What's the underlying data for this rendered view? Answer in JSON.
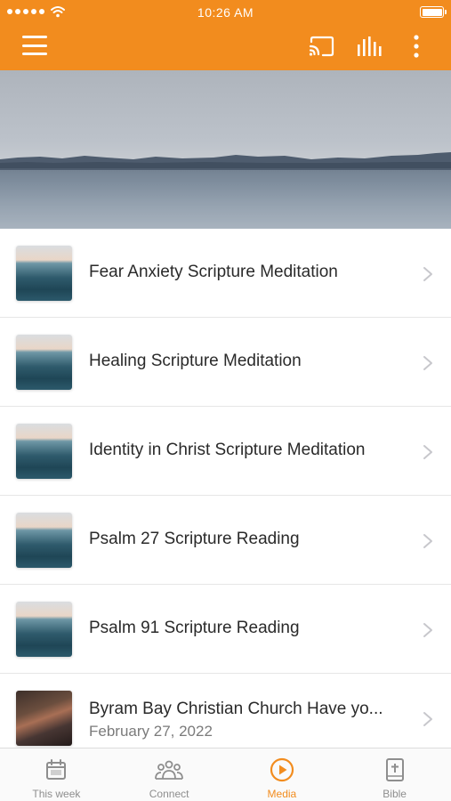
{
  "status_bar": {
    "time": "10:26 AM",
    "signal_icon": "signal-dots-icon",
    "wifi_icon": "wifi-icon",
    "battery_icon": "battery-icon"
  },
  "header": {
    "accent_color": "#f28c1e",
    "menu_icon": "hamburger-menu-icon",
    "actions": [
      "cast-icon",
      "equalizer-icon",
      "more-vertical-icon"
    ]
  },
  "hero": {
    "image": "lake-mountains-banner"
  },
  "media_list": [
    {
      "title": "Fear Anxiety Scripture Meditation",
      "thumb": "ocean-waves"
    },
    {
      "title": "Healing Scripture Meditation",
      "thumb": "ocean-waves"
    },
    {
      "title": "Identity in Christ Scripture Meditation",
      "thumb": "ocean-waves"
    },
    {
      "title": "Psalm 27 Scripture Reading",
      "thumb": "ocean-waves"
    },
    {
      "title": "Psalm 91 Scripture Reading",
      "thumb": "ocean-waves"
    },
    {
      "title": "Byram Bay Christian Church Have yo...",
      "subtitle": "February 27, 2022",
      "thumb": "church-service"
    }
  ],
  "tab_bar": {
    "tabs": [
      {
        "label": "This week",
        "icon": "calendar-icon",
        "active": false
      },
      {
        "label": "Connect",
        "icon": "people-group-icon",
        "active": false
      },
      {
        "label": "Media",
        "icon": "play-circle-icon",
        "active": true
      },
      {
        "label": "Bible",
        "icon": "bible-cross-icon",
        "active": false
      }
    ],
    "active_color": "#f28c1e",
    "inactive_color": "#8e8e8e"
  }
}
